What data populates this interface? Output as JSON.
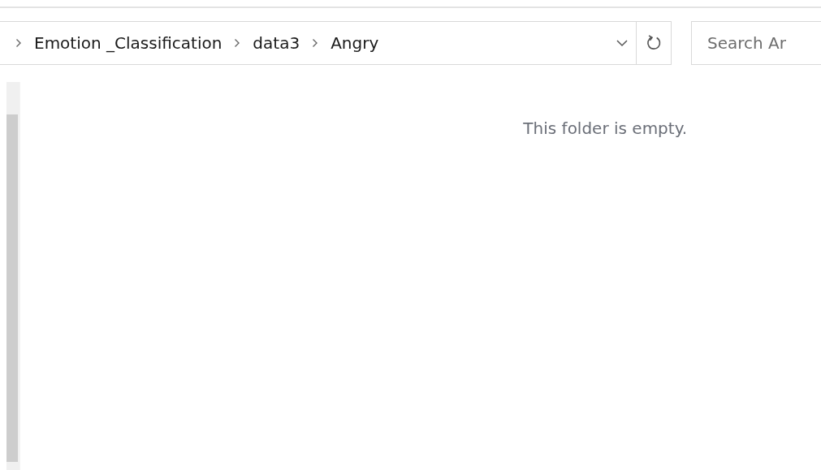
{
  "address_bar": {
    "path": [
      "Emotion _Classification",
      "data3",
      "Angry"
    ]
  },
  "search": {
    "placeholder": "Search Ar"
  },
  "content": {
    "empty_message": "This folder is empty."
  }
}
